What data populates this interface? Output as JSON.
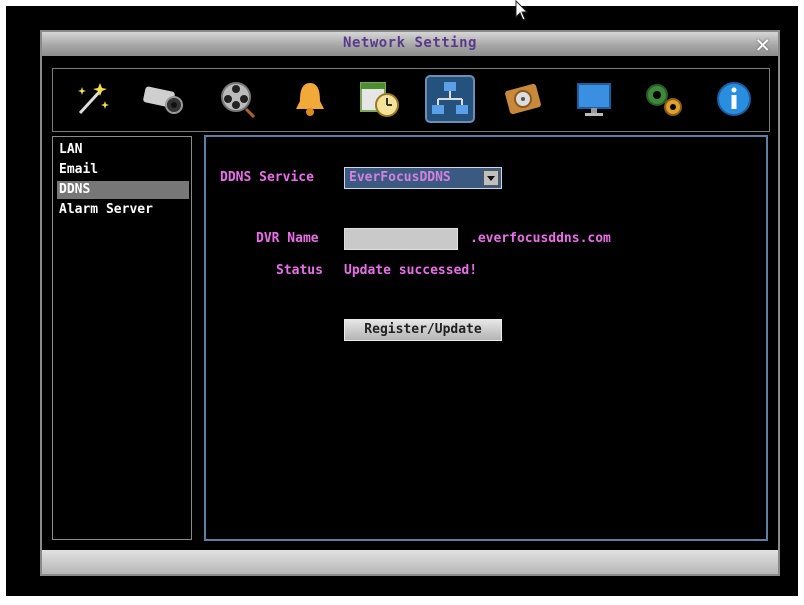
{
  "window": {
    "title": "Network Setting"
  },
  "toolbar": {
    "items": [
      {
        "icon": "magic-wand-icon"
      },
      {
        "icon": "camera-icon"
      },
      {
        "icon": "film-reel-icon"
      },
      {
        "icon": "alarm-bell-icon"
      },
      {
        "icon": "schedule-clock-icon"
      },
      {
        "icon": "network-icon",
        "active": true
      },
      {
        "icon": "hard-disk-icon"
      },
      {
        "icon": "monitor-icon"
      },
      {
        "icon": "gears-icon"
      },
      {
        "icon": "info-icon"
      }
    ]
  },
  "sidebar": {
    "items": [
      {
        "label": "LAN"
      },
      {
        "label": "Email"
      },
      {
        "label": "DDNS",
        "active": true
      },
      {
        "label": "Alarm Server"
      }
    ]
  },
  "ddns": {
    "service_label": "DDNS Service",
    "service_value": "EverFocusDDNS",
    "name_label": "DVR Name",
    "name_value": "",
    "domain_suffix": ".everfocusddns.com",
    "status_label": "Status",
    "status_value": "Update successed!",
    "register_button": "Register/Update"
  },
  "colors": {
    "label": "#e96fe9",
    "active_tab": "#24527d",
    "content_border": "#5d7fa3"
  }
}
